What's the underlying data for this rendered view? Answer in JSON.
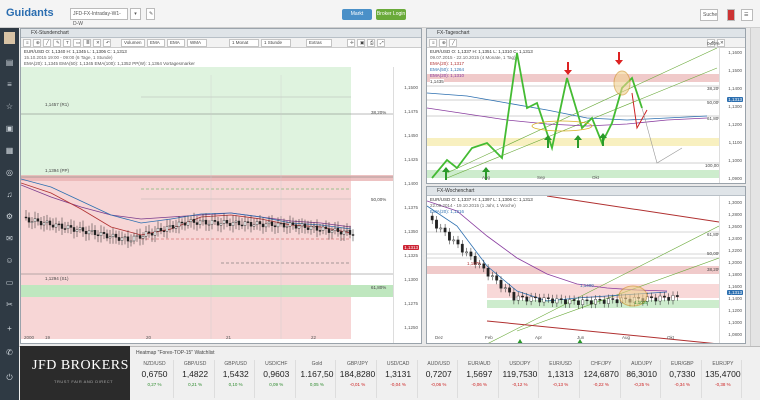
{
  "app": {
    "logo": "Guidants",
    "workspace_label": "JFD-FX-Intraday-W1-D-W",
    "account": "Markt",
    "login": "Broker Login",
    "search": "Suche"
  },
  "left_chart": {
    "title": "FX-Stundenchart",
    "toolbar": [
      "Volumen",
      "EMA",
      "EMA",
      "WMA",
      "1 Monat",
      "1 Stunde",
      "Extras"
    ],
    "legend1": "EUR/USD  O: 1,1340  H: 1,1345  L: 1,1306  C: 1,1313",
    "legend2": "15.10.2015 19:00 - 09:00 (6 Tage, 1 Stunde)",
    "legend3": "EMA(20): 1,1345   EMA(50): 1,1345   EMA(100): 1,1352   PP(W): 1,1364   Vortagesmarker",
    "levels": {
      "r1": "1,1457 (R1)",
      "pp": "1,1394 (PP)",
      "s1": "1,1294 (S1)"
    },
    "fibs": [
      "38,20%",
      "50,00%",
      "61,80%"
    ],
    "yticks": [
      "1,1500",
      "1,1475",
      "1,1450",
      "1,1425",
      "1,1400",
      "1,1375",
      "1,1350",
      "1,1325",
      "1,1300",
      "1,1275",
      "1,1250"
    ],
    "price_tag": "1,1313",
    "xticks": [
      "19",
      "20",
      "21",
      "22"
    ],
    "bottom_label": "2000"
  },
  "top_right_chart": {
    "title": "FX-Tageschart",
    "legend1": "EUR/USD  O: 1,1337  H: 1,1351  L: 1,1310  C: 1,1313",
    "legend2": "09.07.2015 - 22.10.2015 (4 Monate, 1 Tag)",
    "legend3": "EMA(20): 1,1317",
    "legend4": "EMA(50): 1,1264",
    "legend5": "EMA(20): 1,1310",
    "level_left": "1,1435",
    "fibs": [
      "0,00%",
      "38,20%",
      "50,00%",
      "61,80%",
      "100,00%"
    ],
    "yticks": [
      "1,1600",
      "1,1500",
      "1,1400",
      "1,1300",
      "1,1200",
      "1,1100",
      "1,1000",
      "1,0900"
    ],
    "price_tag": "1,1313",
    "xticks": [
      "Aug",
      "Sep",
      "Okt"
    ]
  },
  "bottom_right_chart": {
    "title": "FX-Wochenchart",
    "legend1": "EUR/USD  O: 1,1337  H: 1,1397  L: 1,1306  C: 1,1313",
    "legend2": "22.09.2014 - 19.10.2015 (1 Jahr, 1 Woche)",
    "legend3": "EMA(20): 1,1216",
    "level_a": "1,1400",
    "level_b": "1,1025",
    "level_c": "1,1875",
    "fibs": [
      "61,80%",
      "50,00%",
      "38,20%"
    ],
    "yticks": [
      "1,3000",
      "1,2800",
      "1,2600",
      "1,2400",
      "1,2200",
      "1,2000",
      "1,1800",
      "1,1600",
      "1,1400",
      "1,1200",
      "1,1000",
      "1,0800"
    ],
    "price_tag": "1,1313",
    "xticks": [
      "Dez",
      "Feb",
      "Apr",
      "Jun",
      "Aug",
      "Okt"
    ]
  },
  "watchlist": {
    "title": "Heatmap \"Forex-TOP-15\" Watchlist",
    "brand": "JFD BROKERS",
    "brand_sub": "TRUST FAIR AND DIRECT",
    "items": [
      {
        "name": "NZD/USD",
        "price": "0,6750",
        "change": "0,27 %",
        "dir": "up"
      },
      {
        "name": "GBP/USD",
        "price": "1,4822",
        "change": "0,21 %",
        "dir": "up"
      },
      {
        "name": "GBP/USD",
        "price": "1,5432",
        "change": "0,10 %",
        "dir": "up"
      },
      {
        "name": "USD/CHF",
        "price": "0,9603",
        "change": "0,09 %",
        "dir": "up"
      },
      {
        "name": "Gold",
        "price": "1.167,50",
        "change": "0,05 %",
        "dir": "up"
      },
      {
        "name": "GBP/JPY",
        "price": "184,8280",
        "change": "-0,01 %",
        "dir": "down"
      },
      {
        "name": "USD/CAD",
        "price": "1,3131",
        "change": "-0,04 %",
        "dir": "down"
      },
      {
        "name": "AUD/USD",
        "price": "0,7207",
        "change": "-0,06 %",
        "dir": "down"
      },
      {
        "name": "EUR/AUD",
        "price": "1,5697",
        "change": "-0,06 %",
        "dir": "down"
      },
      {
        "name": "USD/JPY",
        "price": "119,7530",
        "change": "-0,12 %",
        "dir": "down"
      },
      {
        "name": "EUR/USD",
        "price": "1,1313",
        "change": "-0,13 %",
        "dir": "down"
      },
      {
        "name": "CHF/JPY",
        "price": "124,6870",
        "change": "-0,22 %",
        "dir": "down"
      },
      {
        "name": "AUD/JPY",
        "price": "86,3010",
        "change": "-0,25 %",
        "dir": "down"
      },
      {
        "name": "EUR/GBP",
        "price": "0,7330",
        "change": "-0,34 %",
        "dir": "down"
      },
      {
        "name": "EUR/JPY",
        "price": "135,4700",
        "change": "-0,38 %",
        "dir": "down"
      }
    ]
  },
  "colors": {
    "up": "#2e8b2e",
    "down": "#cc2222",
    "accent": "#4a90c8",
    "sidebar": "#2f3a44"
  }
}
